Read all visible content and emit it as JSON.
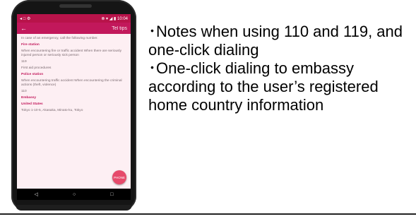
{
  "phone": {
    "status_left": "◂ □ ⚙",
    "status_right": "⊗ ▾ ◢ ▮ 10:04",
    "appbar_back": "←",
    "appbar_title": "Tel tips",
    "lines": [
      {
        "text": "In case of an emergency, call the following number.",
        "kind": "body"
      },
      {
        "text": "Fire station",
        "kind": "header"
      },
      {
        "text": "When encountering fire or traffic accident When there are seriously injured person or seriously sick person",
        "kind": "body"
      },
      {
        "text": "119",
        "kind": "body"
      },
      {
        "text": "First aid procedures",
        "kind": "body"
      },
      {
        "text": "Police station",
        "kind": "header"
      },
      {
        "text": "When encountering traffic accident When encountering the criminal actions (theft, violence)",
        "kind": "body"
      },
      {
        "text": "110",
        "kind": "body"
      },
      {
        "text": "Embassy",
        "kind": "header"
      },
      {
        "text": "United States",
        "kind": "header"
      },
      {
        "text": "Tokyo 1-10-5, Akasaka, Minato-ku, Tokyo",
        "kind": "body"
      }
    ],
    "fab_label": "PHONE",
    "nav": {
      "back": "◁",
      "home": "○",
      "recents": "□"
    }
  },
  "bullets": [
    "･Notes when using 110 and 119, and one-click dialing",
    "･One-click dialing to embassy according to the user’s registered home country information"
  ]
}
